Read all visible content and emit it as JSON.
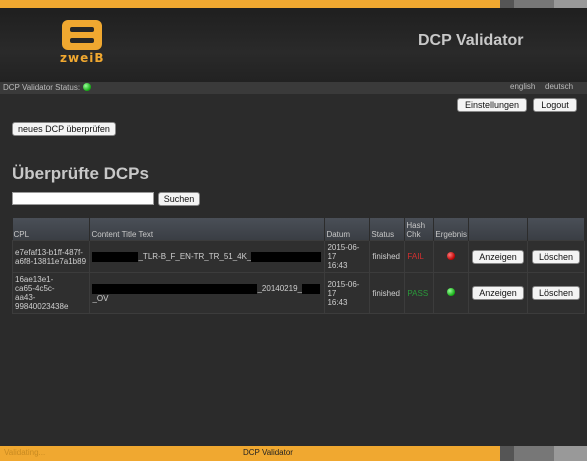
{
  "header": {
    "title": "DCP Validator",
    "logo_text": "zweiB"
  },
  "statusbar": {
    "label": "DCP Validator Status:",
    "lang_en": "english",
    "lang_de": "deutsch"
  },
  "actions": {
    "settings": "Einstellungen",
    "logout": "Logout",
    "new_dcp": "neues DCP überprüfen"
  },
  "main": {
    "title": "Überprüfte DCPs",
    "search_button": "Suchen"
  },
  "table": {
    "headers": [
      "CPL",
      "Content Title Text",
      "Datum",
      "Status",
      "Hash Chk",
      "Ergebnis"
    ],
    "rows": [
      {
        "cpl": [
          "e7efaf13-b1ff-487f-",
          "a6f8-13811e7a1b89"
        ],
        "title_mid": "_TLR-B_F_EN-TR_TR_51_4K_",
        "date": [
          "2015-06-17",
          "16:43"
        ],
        "status": "finished",
        "hash": "FAIL",
        "result": "red",
        "view": "Anzeigen",
        "delete": "Löschen"
      },
      {
        "cpl": [
          "16ae13e1-",
          "ca65-4c5c-",
          "aa43-99840023438e"
        ],
        "title_mid": "_20140219_",
        "title_end": "_OV",
        "date": [
          "2015-06-17",
          "16:43"
        ],
        "status": "finished",
        "hash": "PASS",
        "result": "green",
        "view": "Anzeigen",
        "delete": "Löschen"
      }
    ]
  },
  "footer": {
    "label": "DCP Validator",
    "faint": "Validating..."
  },
  "colors": {
    "accent": "#f0a830",
    "fail": "#d03030",
    "pass": "#2a9a3a"
  }
}
